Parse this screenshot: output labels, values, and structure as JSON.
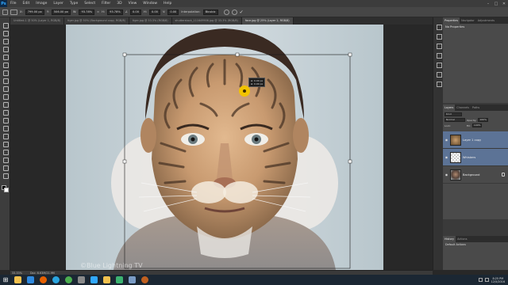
{
  "app": {
    "logo": "Ps"
  },
  "menu": [
    "File",
    "Edit",
    "Image",
    "Layer",
    "Type",
    "Select",
    "Filter",
    "3D",
    "View",
    "Window",
    "Help"
  ],
  "window_controls": [
    "–",
    "□",
    "✕"
  ],
  "options_bar": {
    "x_value": "799.00 px",
    "y_value": "506.00 px",
    "w_value": "93.78%",
    "h_value": "93.78%",
    "angle_value": "0.00",
    "h_skew": "0.00",
    "v_skew": "0.00",
    "interpolation_label": "Interpolation:",
    "interpolation_value": "Bicubic"
  },
  "tabs": [
    {
      "label": "Untitled-1 @ 50% (Layer 1, RGB/8)"
    },
    {
      "label": "tiger.jpg @ 50% (Background copy, RGB/8)"
    },
    {
      "label": "tiger.jpg @ 33.3% (RGB/8)"
    },
    {
      "label": "shutterstock_111649906.jpg @ 33.3% (RGB/8)"
    },
    {
      "label": "face.jpg @ 25% (Layer 2, RGB/8)"
    }
  ],
  "canvas": {
    "tooltip": [
      "Δ: 0.00 px",
      "Δ: 0.00 px"
    ],
    "watermark": "©Blue Lightning TV"
  },
  "status": {
    "zoom": "33.33%",
    "doc": "Doc: 6.63M/21.9M"
  },
  "panels": {
    "top_tabs": [
      "Properties",
      "Navigator",
      "Adjustments"
    ],
    "properties_text": "No Properties",
    "layer_tabs": [
      "Layers",
      "Channels",
      "Paths"
    ],
    "kind": "Kind",
    "blend_mode": "Normal",
    "opacity_label": "Opacity:",
    "opacity_value": "100%",
    "lock_label": "Lock:",
    "fill_label": "Fill:",
    "fill_value": "100%",
    "layers": [
      {
        "name": "Layer 1 copy",
        "thumb": "tiger",
        "selected": true
      },
      {
        "name": "Whiskers",
        "thumb": "white",
        "selected": true
      },
      {
        "name": "Background",
        "thumb": "bg",
        "selected": false
      }
    ],
    "history_tabs": [
      "History",
      "Actions"
    ],
    "history_item": "Default Actions"
  },
  "taskbar": {
    "time": "8:25 PM",
    "date": "12/5/2016",
    "apps": [
      {
        "name": "explorer",
        "color": "#f2c14e"
      },
      {
        "name": "media",
        "color": "#2f8ae0"
      },
      {
        "name": "firefox",
        "color": "#e66000"
      },
      {
        "name": "skype",
        "color": "#2aa5e0"
      },
      {
        "name": "chrome",
        "color": "#4caf50"
      },
      {
        "name": "mail",
        "color": "#8a8a8a"
      },
      {
        "name": "photoshop",
        "color": "#31a8ff"
      },
      {
        "name": "folder",
        "color": "#f2c14e"
      },
      {
        "name": "camtasia",
        "color": "#3cb371"
      },
      {
        "name": "lightroom",
        "color": "#7a9cc6"
      },
      {
        "name": "firefox-dev",
        "color": "#c06020"
      }
    ]
  }
}
